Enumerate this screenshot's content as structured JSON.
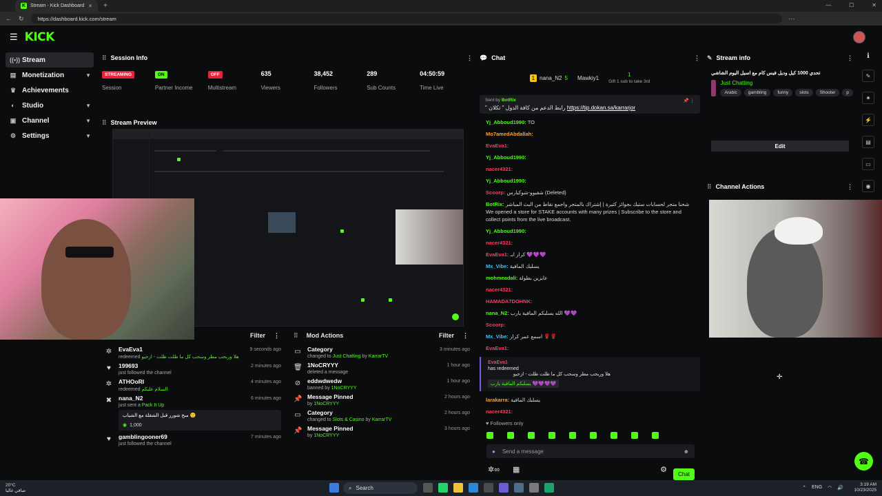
{
  "browser": {
    "tab_title": "Stream - Kick Dashboard",
    "url": "https://dashboard.kick.com/stream"
  },
  "app": {
    "logo_text": "KICK"
  },
  "sidebar": {
    "items": [
      {
        "label": "Stream",
        "icon": "broadcast-icon"
      },
      {
        "label": "Monetization",
        "icon": "dollar-icon"
      },
      {
        "label": "Achievements",
        "icon": "trophy-icon"
      },
      {
        "label": "Studio",
        "icon": "studio-icon"
      },
      {
        "label": "Channel",
        "icon": "channel-icon"
      },
      {
        "label": "Settings",
        "icon": "gear-icon"
      }
    ]
  },
  "session": {
    "title": "Session Info",
    "stats": [
      {
        "value": "STREAMING",
        "label": "Session",
        "badge": "red"
      },
      {
        "value": "ON",
        "label": "Partner Income",
        "badge": "green"
      },
      {
        "value": "OFF",
        "label": "Multistream",
        "badge": "red"
      },
      {
        "value": "635",
        "label": "Viewers"
      },
      {
        "value": "38,452",
        "label": "Followers"
      },
      {
        "value": "289",
        "label": "Sub Counts"
      },
      {
        "value": "04:50:59",
        "label": "Time Live"
      }
    ]
  },
  "preview": {
    "title": "Stream Preview"
  },
  "activity": {
    "filter_label": "Filter",
    "items": [
      {
        "name": "EvaEva1",
        "action": "redeemed",
        "detail": "هلا وربحب مطر وسحب كل ما ظلت ظلت - ازحيو",
        "time": "9 seconds ago"
      },
      {
        "name": "199693",
        "action": "just followed the channel",
        "detail": "",
        "time": "2 minutes ago"
      },
      {
        "name": "ATHOoRI",
        "action": "redeemed",
        "detail": "السلام عليكم",
        "time": "4 minutes ago"
      },
      {
        "name": "nana_N2",
        "action": "just sent a",
        "detail": "Pack It Up",
        "time": "6 minutes ago",
        "gift_text": "مبخ شورر قبل الشقلة مع الشياب 🙂",
        "gift_amount": "1,000"
      },
      {
        "name": "gamblingooner69",
        "action": "just followed the channel",
        "detail": "",
        "time": "7 minutes ago"
      }
    ]
  },
  "mod_actions": {
    "title": "Mod Actions",
    "filter_label": "Filter",
    "items": [
      {
        "name": "Category",
        "line": "changed to",
        "hl": "Just Chatting",
        "by": "by",
        "mod": "KarrarTV",
        "time": "3 minutes ago"
      },
      {
        "name": "1NoCRYYY",
        "line": "deleted a message",
        "hl": "",
        "by": "",
        "mod": "",
        "time": "1 hour ago"
      },
      {
        "name": "eddwdwedw",
        "line": "banned by",
        "hl": "",
        "by": "",
        "mod": "1NoCRYYY",
        "time": "1 hour ago"
      },
      {
        "name": "Message Pinned",
        "line": "by",
        "hl": "",
        "by": "",
        "mod": "1NoCRYYY",
        "time": "2 hours ago"
      },
      {
        "name": "Category",
        "line": "changed to",
        "hl": "Slots & Casino",
        "by": "by",
        "mod": "KarrarTV",
        "time": "2 hours ago"
      },
      {
        "name": "Message Pinned",
        "line": "by",
        "hl": "",
        "by": "",
        "mod": "1NoCRYYY",
        "time": "3 hours ago"
      }
    ]
  },
  "chat": {
    "title": "Chat",
    "top_gifter_1": "nana_N2",
    "top_gifter_1_count": "5",
    "top_gifter_2": "Mawkiy1",
    "top_gifter_3_count": "1",
    "gift_prompt": "Gift 1 sub to take 3rd",
    "pinned_by": "Sent by",
    "pinned_user": "BotRix",
    "pinned_text": "\" رابط الدعم من كافة الدول \" تكلان",
    "pinned_link": "https://tip.dokan.sa/karrarjor",
    "messages": [
      {
        "user": "Yj_Abboud1990:",
        "text": "TO",
        "color": "gr"
      },
      {
        "user": "Mo7amedAbdallah:",
        "text": "",
        "color": "or"
      },
      {
        "user": "EvaEva1:",
        "text": "",
        "color": "rd"
      },
      {
        "user": "Yj_Abboud1990:",
        "text": "",
        "color": "gr"
      },
      {
        "user": "nacer4321:",
        "text": "",
        "color": "rd"
      },
      {
        "user": "Yj_Abboud1990:",
        "text": "",
        "color": "gr"
      },
      {
        "user": "Scoorp:",
        "text": "شقيوو-شوكيارس (Deleted)",
        "color": "rd"
      },
      {
        "user": "BotRix:",
        "text": "شحنا متجر لحسابات ستيك بجوائز كثيرة | إشتراك بالمتجر واجمع نقاط من البث المباشر We opened a store for STAKE accounts with many prizes | Subscribe to the store and collect points from the live broadcast.",
        "color": "gr"
      },
      {
        "user": "Yj_Abboud1990:",
        "text": "",
        "color": "gr"
      },
      {
        "user": "nacer4321:",
        "text": "",
        "color": "rd"
      },
      {
        "user": "EvaEva1:",
        "text": "كرار ابـ 💜💜💜",
        "color": "rd"
      },
      {
        "user": "Mx_Vibe:",
        "text": "يسلبك المافية",
        "color": "bl"
      },
      {
        "user": "mohmeadali:",
        "text": "عايزين بطولة",
        "color": "gr"
      },
      {
        "user": "nacer4321:",
        "text": "",
        "color": "rd"
      },
      {
        "user": "HAMADA7DOHNK:",
        "text": "",
        "color": "rd"
      },
      {
        "user": "nana_N2:",
        "text": "الله يسلبكم المافية يارب 💜💜",
        "color": "gr"
      },
      {
        "user": "Scoorp:",
        "text": "",
        "color": "rd"
      },
      {
        "user": "Mx_Vibe:",
        "text": "اسمع عمر كرار 🌹🌹",
        "color": "bl"
      },
      {
        "user": "EvaEva1:",
        "text": "",
        "color": "rd"
      }
    ],
    "redeem_user": "EvaEva1",
    "redeem_action": "has redeemed",
    "redeem_title": "هلا وربحب مطر وسحب كل ما ظلت ظلت - ازحيو",
    "redeem_msg": "يسلبكم المافية يارب 💜💜💜💜",
    "after": [
      {
        "user": "larakarra:",
        "text": "يسلبك المافية",
        "color": "or"
      },
      {
        "user": "nacer4321:",
        "text": "",
        "color": "rd"
      }
    ],
    "followers_only": "Followers only",
    "input_placeholder": "Send a message",
    "send_label": "Chat"
  },
  "stream_info": {
    "title": "Stream info",
    "stream_title": "تحدي 1000 كيل وديل فيس كام مع اسيل اليوم الشاشي",
    "category": "Just Chatting",
    "tags": [
      "Arabic",
      "gambling",
      "funny",
      "slots",
      "Shooter",
      "p"
    ],
    "edit_label": "Edit"
  },
  "channel_actions": {
    "title": "Channel Actions"
  },
  "taskbar": {
    "weather_temp": "20°C",
    "weather_desc": "صافي غالبا",
    "search_label": "Search",
    "lang": "ENG",
    "time": "3:19 AM",
    "date": "10/23/2025"
  }
}
